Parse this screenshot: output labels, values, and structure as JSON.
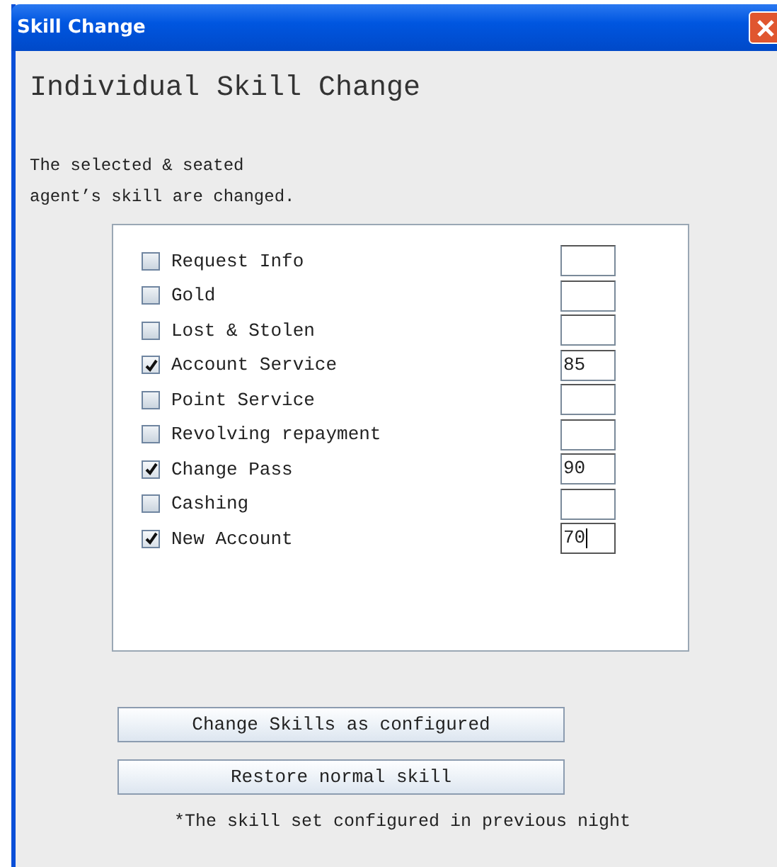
{
  "window": {
    "title": "Skill Change"
  },
  "heading": "Individual Skill Change",
  "description": [
    "The selected & seated",
    "agent’s skill are changed."
  ],
  "skills": [
    {
      "label": "Request Info",
      "checked": false,
      "focused": false
    },
    {
      "label": "Gold",
      "checked": false,
      "focused": false
    },
    {
      "label": "Lost & Stolen",
      "checked": false,
      "focused": false
    },
    {
      "label": "Account Service",
      "checked": true,
      "value": "85",
      "focused": false
    },
    {
      "label": "Point Service",
      "checked": false,
      "focused": false
    },
    {
      "label": "Revolving repayment",
      "checked": false,
      "focused": false
    },
    {
      "label": "Change Pass",
      "checked": true,
      "value": "90",
      "focused": false
    },
    {
      "label": "Cashing",
      "checked": false,
      "focused": false
    },
    {
      "label": "New Account",
      "checked": true,
      "value": "70",
      "focused": true
    }
  ],
  "buttons": [
    "Change Skills as configured",
    "Restore normal skill"
  ],
  "footnote": "*The skill set configured in previous night"
}
